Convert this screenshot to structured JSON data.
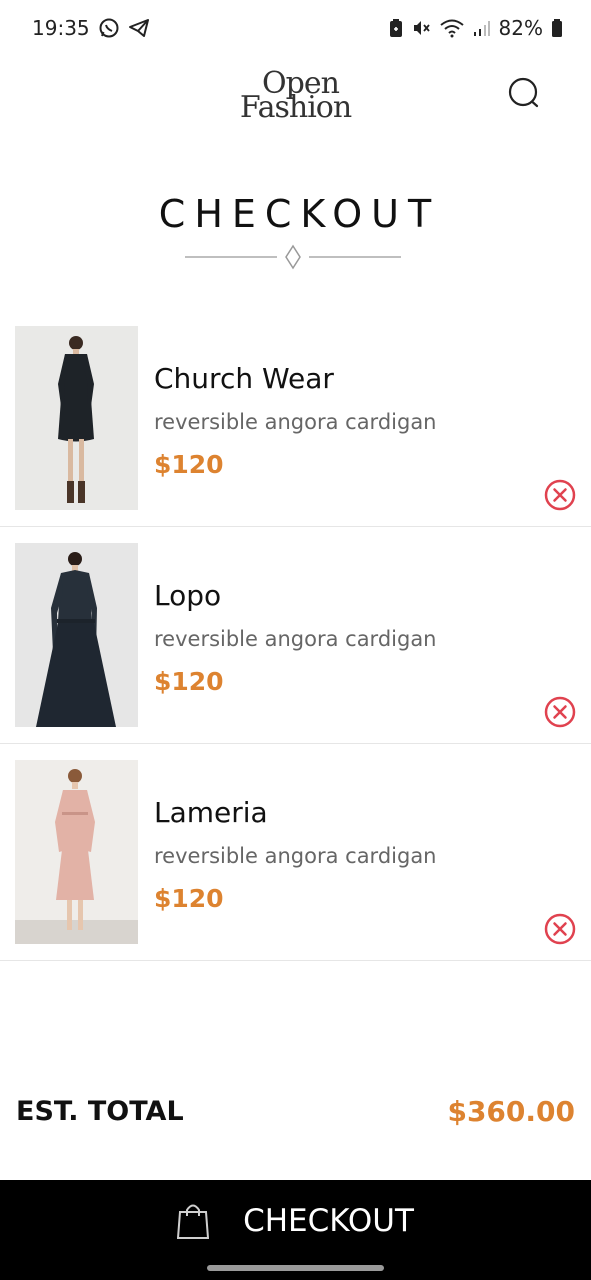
{
  "status_bar": {
    "time": "19:35",
    "battery": "82%",
    "icons": [
      "whatsapp-icon",
      "telegram-icon",
      "battery-saver-icon",
      "mute-icon",
      "wifi-icon",
      "signal-icon",
      "battery-icon"
    ]
  },
  "header": {
    "logo_line1": "Open",
    "logo_line2": "Fashion",
    "search_icon": "search-icon"
  },
  "page": {
    "title": "CHECKOUT"
  },
  "cart": {
    "items": [
      {
        "name": "Church Wear",
        "description": "reversible angora cardigan",
        "price": "$120",
        "image": "dark-navy-dress-photo"
      },
      {
        "name": "Lopo",
        "description": "reversible angora cardigan",
        "price": "$120",
        "image": "navy-coat-dress-photo"
      },
      {
        "name": "Lameria",
        "description": "reversible angora cardigan",
        "price": "$120",
        "image": "pink-dress-photo"
      }
    ]
  },
  "total": {
    "label": "EST. TOTAL",
    "value": "$360.00"
  },
  "checkout_button": {
    "label": "CHECKOUT",
    "icon": "shopping-bag-icon"
  },
  "colors": {
    "accent": "#dd8330",
    "remove": "#e0424f",
    "checkout_bg": "#000000"
  }
}
